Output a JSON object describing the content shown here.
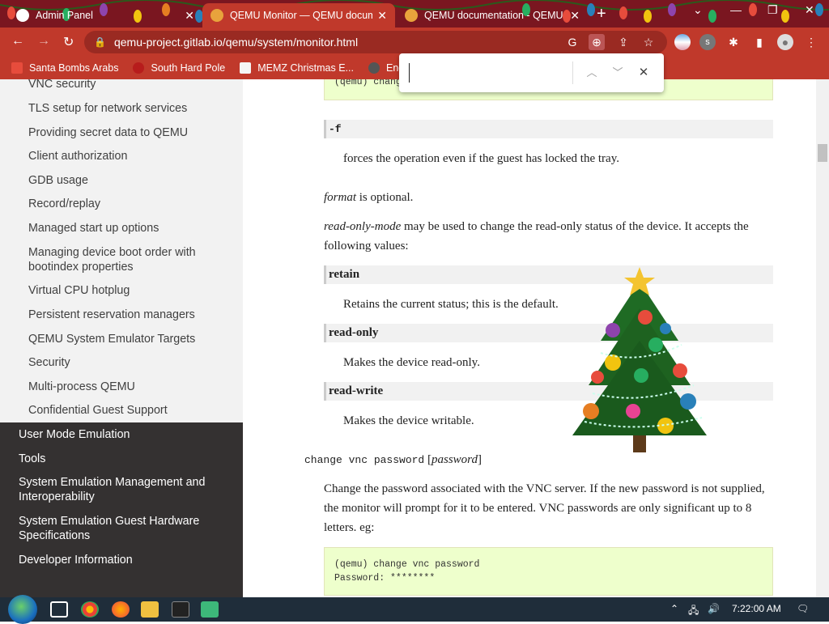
{
  "browser": {
    "tabs": [
      {
        "title": "Admin Panel",
        "active": false
      },
      {
        "title": "QEMU Monitor — QEMU docum",
        "active": true
      },
      {
        "title": "QEMU documentation - QEMU",
        "active": false
      }
    ],
    "url": "qemu-project.gitlab.io/qemu/system/monitor.html",
    "bookmarks": [
      "Santa Bombs Arabs",
      "South Hard Pole",
      "MEMZ Christmas E...",
      "Enderm"
    ]
  },
  "find_bar": {
    "value": ""
  },
  "sidebar": {
    "sub_items": [
      "VNC security",
      "TLS setup for network services",
      "Providing secret data to QEMU",
      "Client authorization",
      "GDB usage",
      "Record/replay",
      "Managed start up options",
      "Managing device boot order with bootindex properties",
      "Virtual CPU hotplug",
      "Persistent reservation managers",
      "QEMU System Emulator Targets",
      "Security",
      "Multi-process QEMU",
      "Confidential Guest Support"
    ],
    "sections": [
      "User Mode Emulation",
      "Tools",
      "System Emulation Management and Interoperability",
      "System Emulation Guest Hardware Specifications",
      "Developer Information"
    ]
  },
  "doc": {
    "top_code": "(qemu) change",
    "opt_f": "-f",
    "opt_f_desc": "forces the operation even if the guest has locked the tray.",
    "format_word": "format",
    "format_rest": " is optional.",
    "rom_word": "read-only-mode",
    "rom_rest": " may be used to change the read-only status of the device. It accepts the following values:",
    "opt_retain": "retain",
    "opt_retain_desc": "Retains the current status; this is the default.",
    "opt_ro": "read-only",
    "opt_ro_desc": "Makes the device read-only.",
    "opt_rw": "read-write",
    "opt_rw_desc": "Makes the device writable.",
    "cmd_name": "change vnc password",
    "cmd_arg": "password",
    "cmd_desc": "Change the password associated with the VNC server. If the new password is not supplied, the monitor will prompt for it to be entered. VNC passwords are only significant up to 8 letters. eg:",
    "code_line1": "(qemu) change vnc password",
    "code_line2": "Password: ********"
  },
  "taskbar": {
    "time": "7:22:00 AM"
  }
}
